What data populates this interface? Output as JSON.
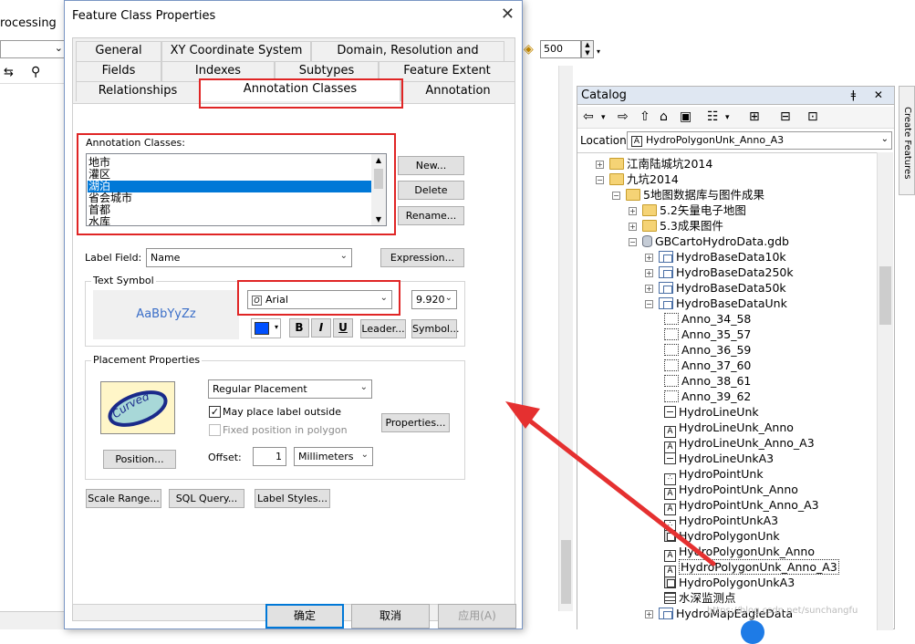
{
  "background": {
    "processing_label": "rocessing",
    "scale_value": "500"
  },
  "dialog": {
    "title": "Feature Class Properties",
    "close": "✕",
    "tabs_row1": [
      "General",
      "XY Coordinate System",
      "Domain, Resolution and Tolerance"
    ],
    "tabs_row2": [
      "Fields",
      "Indexes",
      "Subtypes",
      "Feature Extent"
    ],
    "tabs_row3": [
      "Relationships",
      "Annotation Classes",
      "Annotation"
    ],
    "annotation_classes": {
      "label": "Annotation Classes:",
      "items": [
        "地市",
        "灌区",
        "湖泊",
        "省会城市",
        "首都",
        "水库"
      ],
      "selected_index": 2,
      "new_button": "New...",
      "delete_button": "Delete",
      "rename_button": "Rename..."
    },
    "label_field": {
      "label": "Label Field:",
      "value": "Name",
      "expression_button": "Expression..."
    },
    "text_symbol": {
      "group_title": "Text Symbol",
      "sample": "AaBbYyZz",
      "font": "Arial",
      "size": "9.920",
      "bold": "B",
      "italic": "I",
      "underline": "U",
      "leader_button": "Leader...",
      "symbol_button": "Symbol...",
      "color": "#0050ff"
    },
    "placement": {
      "group_title": "Placement Properties",
      "placement_value": "Regular Placement",
      "curved_label": "Curved",
      "may_place_outside": "May place label outside",
      "may_place_outside_checked": "✓",
      "fixed_position": "Fixed position in polygon",
      "properties_button": "Properties...",
      "position_button": "Position...",
      "offset_label": "Offset:",
      "offset_value": "1",
      "offset_unit": "Millimeters"
    },
    "bottom_row": {
      "scale_range": "Scale Range...",
      "sql_query": "SQL Query...",
      "label_styles": "Label Styles..."
    },
    "ok": "确定",
    "cancel": "取消",
    "apply": "应用(A)"
  },
  "catalog": {
    "title": "Catalog",
    "controls": "ǂ ✕",
    "location_label": "Location:",
    "location_value": "HydroPolygonUnk_Anno_A3",
    "location_icon": "A",
    "side_tab": "Create Features",
    "tree": [
      {
        "label": "江南陆城坑2014",
        "indent": 1,
        "expander": "+",
        "icon": "folder"
      },
      {
        "label": "九坑2014",
        "indent": 1,
        "expander": "−",
        "icon": "folder"
      },
      {
        "label": "5地图数据库与图件成果",
        "indent": 2,
        "expander": "−",
        "icon": "folder"
      },
      {
        "label": "5.2矢量电子地图",
        "indent": 3,
        "expander": "+",
        "icon": "folder"
      },
      {
        "label": "5.3成果图件",
        "indent": 3,
        "expander": "+",
        "icon": "folder"
      },
      {
        "label": "GBCartoHydroData.gdb",
        "indent": 3,
        "expander": "−",
        "icon": "gdb"
      },
      {
        "label": "HydroBaseData10k",
        "indent": 4,
        "expander": "+",
        "icon": "dataset"
      },
      {
        "label": "HydroBaseData250k",
        "indent": 4,
        "expander": "+",
        "icon": "dataset"
      },
      {
        "label": "HydroBaseData50k",
        "indent": 4,
        "expander": "+",
        "icon": "dataset"
      },
      {
        "label": "HydroBaseDataUnk",
        "indent": 4,
        "expander": "−",
        "icon": "dataset"
      },
      {
        "label": "Anno_34_58",
        "indent": 5,
        "expander": "",
        "icon": "anno-group"
      },
      {
        "label": "Anno_35_57",
        "indent": 5,
        "expander": "",
        "icon": "anno-group"
      },
      {
        "label": "Anno_36_59",
        "indent": 5,
        "expander": "",
        "icon": "anno-group"
      },
      {
        "label": "Anno_37_60",
        "indent": 5,
        "expander": "",
        "icon": "anno-group"
      },
      {
        "label": "Anno_38_61",
        "indent": 5,
        "expander": "",
        "icon": "anno-group"
      },
      {
        "label": "Anno_39_62",
        "indent": 5,
        "expander": "",
        "icon": "anno-group"
      },
      {
        "label": "HydroLineUnk",
        "indent": 5,
        "expander": "",
        "icon": "line"
      },
      {
        "label": "HydroLineUnk_Anno",
        "indent": 5,
        "expander": "",
        "icon": "anno"
      },
      {
        "label": "HydroLineUnk_Anno_A3",
        "indent": 5,
        "expander": "",
        "icon": "anno"
      },
      {
        "label": "HydroLineUnkA3",
        "indent": 5,
        "expander": "",
        "icon": "line"
      },
      {
        "label": "HydroPointUnk",
        "indent": 5,
        "expander": "",
        "icon": "point"
      },
      {
        "label": "HydroPointUnk_Anno",
        "indent": 5,
        "expander": "",
        "icon": "anno"
      },
      {
        "label": "HydroPointUnk_Anno_A3",
        "indent": 5,
        "expander": "",
        "icon": "anno"
      },
      {
        "label": "HydroPointUnkA3",
        "indent": 5,
        "expander": "",
        "icon": "point"
      },
      {
        "label": "HydroPolygonUnk",
        "indent": 5,
        "expander": "",
        "icon": "poly"
      },
      {
        "label": "HydroPolygonUnk_Anno",
        "indent": 5,
        "expander": "",
        "icon": "anno"
      },
      {
        "label": "HydroPolygonUnk_Anno_A3",
        "indent": 5,
        "expander": "",
        "icon": "anno",
        "selected": true
      },
      {
        "label": "HydroPolygonUnkA3",
        "indent": 5,
        "expander": "",
        "icon": "poly"
      },
      {
        "label": "水深监测点",
        "indent": 5,
        "expander": "",
        "icon": "table"
      },
      {
        "label": "HydroMapEagleData",
        "indent": 4,
        "expander": "+",
        "icon": "dataset"
      }
    ]
  },
  "watermark": "https://blog.csdn.net/sunchangfu",
  "colors": {
    "highlight_red": "#e02525",
    "selection_blue": "#0078d7",
    "catalog_title_bg": "#dfe7f2"
  }
}
